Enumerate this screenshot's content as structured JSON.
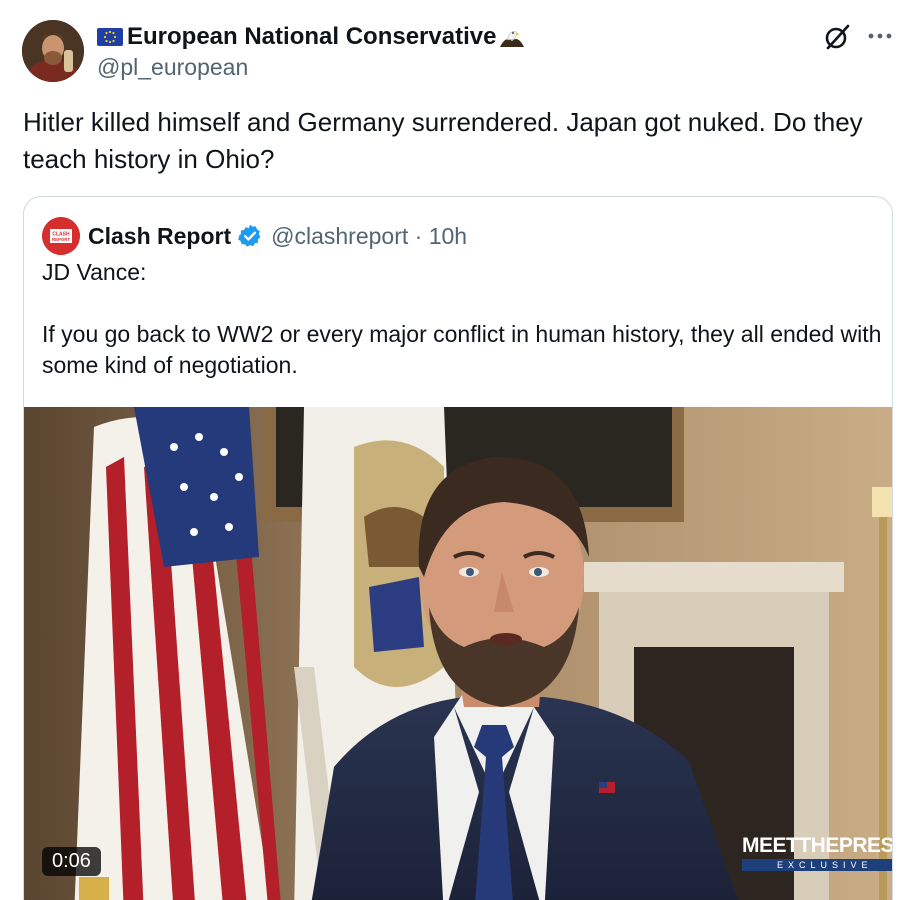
{
  "post": {
    "author": {
      "display_name": "European National Conservative",
      "handle": "@pl_european",
      "flag_icon": "eu-flag-icon",
      "emoji_icon": "eagle-icon"
    },
    "text": "Hitler killed himself and Germany surrendered. Japan got nuked. Do they teach history in Ohio?",
    "actions": {
      "grok_icon": "grok-icon",
      "more_icon": "more-options-icon"
    }
  },
  "quoted": {
    "author_name": "Clash Report",
    "avatar_text": "CLASH REPORT",
    "handle_time": "@clashreport · 10h",
    "verified": true,
    "body_line1": "JD Vance:",
    "body_line2": "If you go back to WW2 or every major conflict in human history, they all ended with some kind of negotiation.",
    "media": {
      "duration": "0:06",
      "watermark_main": "MEETTHEPRESS",
      "watermark_sub": "EXCLUSIVE"
    }
  },
  "colors": {
    "text_primary": "#0f1419",
    "text_secondary": "#536471",
    "border": "#cfd9de",
    "verified_blue": "#1d9bf0",
    "clash_red": "#d62d2d"
  }
}
